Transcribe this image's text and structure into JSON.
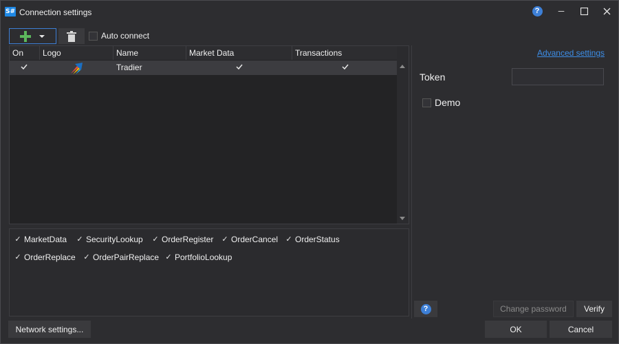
{
  "window": {
    "title": "Connection settings",
    "app_icon_text": "S#",
    "help_glyph": "?",
    "minimize_glyph": "─",
    "maximize_glyph": "☐",
    "close_glyph": "✕"
  },
  "toolbar": {
    "add_icon": "plus-icon",
    "dropdown_icon": "chevron-down-icon",
    "delete_icon": "trash-icon",
    "auto_connect_label": "Auto connect",
    "auto_connect_checked": false
  },
  "grid": {
    "columns": [
      "On",
      "Logo",
      "Name",
      "Market Data",
      "Transactions"
    ],
    "rows": [
      {
        "on": true,
        "logo": "tradier-logo",
        "name": "Tradier",
        "market_data": true,
        "transactions": true
      }
    ]
  },
  "capabilities": [
    {
      "label": "MarketData",
      "checked": true
    },
    {
      "label": "SecurityLookup",
      "checked": true
    },
    {
      "label": "OrderRegister",
      "checked": true
    },
    {
      "label": "OrderCancel",
      "checked": true
    },
    {
      "label": "OrderStatus",
      "checked": true
    },
    {
      "label": "OrderReplace",
      "checked": true
    },
    {
      "label": "OrderPairReplace",
      "checked": true
    },
    {
      "label": "PortfolioLookup",
      "checked": true
    }
  ],
  "right_panel": {
    "advanced_link": "Advanced settings",
    "token_label": "Token",
    "token_value": "",
    "demo_label": "Demo",
    "demo_checked": false,
    "help_glyph": "?",
    "change_password_label": "Change password",
    "verify_label": "Verify"
  },
  "footer": {
    "network_settings_label": "Network settings...",
    "ok_label": "OK",
    "cancel_label": "Cancel"
  },
  "colors": {
    "background": "#2d2d30",
    "accent": "#3d7fd6",
    "link": "#3d8ee8",
    "plus_green": "#5cb85c"
  }
}
